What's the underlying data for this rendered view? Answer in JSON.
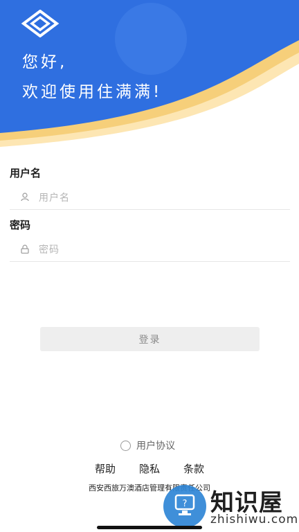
{
  "header": {
    "greeting": "您好,",
    "welcome": "欢迎使用住满满!",
    "colors": {
      "primary": "#2f6fe0",
      "accent": "#f7d27b"
    }
  },
  "form": {
    "username": {
      "label": "用户名",
      "placeholder": "用户名",
      "icon": "user-icon"
    },
    "password": {
      "label": "密码",
      "placeholder": "密码",
      "icon": "lock-icon"
    },
    "login_label": "登录"
  },
  "footer": {
    "agreement_label": "用户协议",
    "links": [
      "帮助",
      "隐私",
      "条款"
    ],
    "company": "西安西旅万澳酒店管理有限责任公司"
  },
  "watermark": {
    "zh": "知识屋",
    "en": "zhishiwu.com"
  }
}
